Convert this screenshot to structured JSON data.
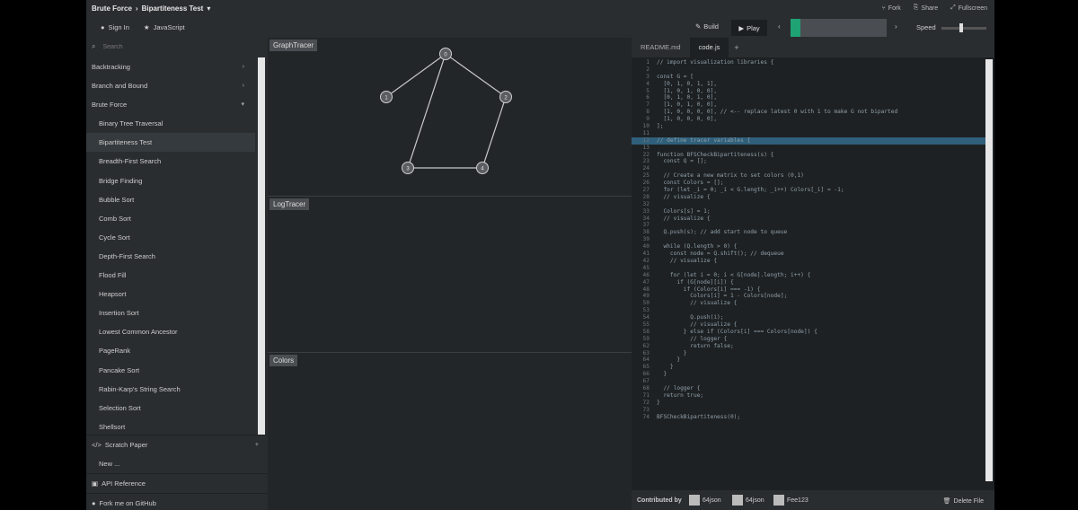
{
  "header": {
    "breadcrumb_root": "Brute Force",
    "breadcrumb_sep": "›",
    "breadcrumb_leaf": "Bipartiteness Test",
    "right_links": [
      "Fork",
      "Share",
      "Fullscreen"
    ]
  },
  "toolbar": {
    "sign_in": "Sign In",
    "language": "JavaScript",
    "build": "Build",
    "play": "Play",
    "speed_label": "Speed",
    "progress": 0.1,
    "speed": 0.4
  },
  "sidebar": {
    "search_placeholder": "Search",
    "items": [
      {
        "label": "Backtracking",
        "type": "category",
        "expanded": false
      },
      {
        "label": "Branch and Bound",
        "type": "category",
        "expanded": false
      },
      {
        "label": "Brute Force",
        "type": "category",
        "expanded": true
      },
      {
        "label": "Binary Tree Traversal",
        "type": "item"
      },
      {
        "label": "Bipartiteness Test",
        "type": "item",
        "active": true
      },
      {
        "label": "Breadth-First Search",
        "type": "item"
      },
      {
        "label": "Bridge Finding",
        "type": "item"
      },
      {
        "label": "Bubble Sort",
        "type": "item"
      },
      {
        "label": "Comb Sort",
        "type": "item"
      },
      {
        "label": "Cycle Sort",
        "type": "item"
      },
      {
        "label": "Depth-First Search",
        "type": "item"
      },
      {
        "label": "Flood Fill",
        "type": "item"
      },
      {
        "label": "Heapsort",
        "type": "item"
      },
      {
        "label": "Insertion Sort",
        "type": "item"
      },
      {
        "label": "Lowest Common Ancestor",
        "type": "item"
      },
      {
        "label": "PageRank",
        "type": "item"
      },
      {
        "label": "Pancake Sort",
        "type": "item"
      },
      {
        "label": "Rabin-Karp's String Search",
        "type": "item"
      },
      {
        "label": "Selection Sort",
        "type": "item"
      },
      {
        "label": "Shellsort",
        "type": "item"
      }
    ],
    "scratch_paper": "Scratch Paper",
    "new_item": "New ...",
    "api_reference": "API Reference",
    "fork_github": "Fork me on GitHub"
  },
  "panels": {
    "graph_tracer": "GraphTracer",
    "log_tracer": "LogTracer",
    "colors": "Colors"
  },
  "graph": {
    "nodes": [
      {
        "id": "0",
        "label": "0"
      },
      {
        "id": "1",
        "label": "1"
      },
      {
        "id": "2",
        "label": "2"
      },
      {
        "id": "3",
        "label": "3"
      },
      {
        "id": "4",
        "label": "4"
      }
    ],
    "edges": [
      [
        "0",
        "1"
      ],
      [
        "0",
        "2"
      ],
      [
        "0",
        "3"
      ],
      [
        "2",
        "4"
      ],
      [
        "3",
        "4"
      ]
    ]
  },
  "editor": {
    "tabs": [
      "README.md",
      "code.js"
    ],
    "active_tab": 1,
    "add_tab": "+",
    "lines": [
      {
        "n": "1",
        "t": "// import visualization libraries {"
      },
      {
        "n": "2",
        "t": ""
      },
      {
        "n": "3",
        "t": "const G = ["
      },
      {
        "n": "4",
        "t": "  [0, 1, 0, 1, 1],"
      },
      {
        "n": "5",
        "t": "  [1, 0, 1, 0, 0],"
      },
      {
        "n": "6",
        "t": "  [0, 1, 0, 1, 0],"
      },
      {
        "n": "7",
        "t": "  [1, 0, 1, 0, 0],"
      },
      {
        "n": "8",
        "t": "  [1, 0, 0, 0, 0], // <-- replace latest 0 with 1 to make G not biparted"
      },
      {
        "n": "9",
        "t": "  [1, 0, 0, 0, 0],"
      },
      {
        "n": "10",
        "t": "];"
      },
      {
        "n": "11",
        "t": ""
      },
      {
        "n": "12",
        "t": "// define tracer variables {",
        "hl": true
      },
      {
        "n": "13",
        "t": ""
      },
      {
        "n": "22",
        "t": "function BFSCheckBipartiteness(s) {"
      },
      {
        "n": "23",
        "t": "  const Q = [];"
      },
      {
        "n": "24",
        "t": ""
      },
      {
        "n": "25",
        "t": "  // Create a new matrix to set colors (0,1)"
      },
      {
        "n": "26",
        "t": "  const Colors = [];"
      },
      {
        "n": "27",
        "t": "  for (let _i = 0; _i < G.length; _i++) Colors[_i] = -1;"
      },
      {
        "n": "28",
        "t": "  // visualize {"
      },
      {
        "n": "32",
        "t": ""
      },
      {
        "n": "33",
        "t": "  Colors[s] = 1;"
      },
      {
        "n": "34",
        "t": "  // visualize {"
      },
      {
        "n": "37",
        "t": ""
      },
      {
        "n": "38",
        "t": "  Q.push(s); // add start node to queue"
      },
      {
        "n": "39",
        "t": ""
      },
      {
        "n": "40",
        "t": "  while (Q.length > 0) {"
      },
      {
        "n": "41",
        "t": "    const node = Q.shift(); // dequeue"
      },
      {
        "n": "42",
        "t": "    // visualize {"
      },
      {
        "n": "45",
        "t": ""
      },
      {
        "n": "46",
        "t": "    for (let i = 0; i < G[node].length; i++) {"
      },
      {
        "n": "47",
        "t": "      if (G[node][i]) {"
      },
      {
        "n": "48",
        "t": "        if (Colors[i] === -1) {"
      },
      {
        "n": "49",
        "t": "          Colors[i] = 1 - Colors[node];"
      },
      {
        "n": "50",
        "t": "          // visualize {"
      },
      {
        "n": "53",
        "t": ""
      },
      {
        "n": "54",
        "t": "          Q.push(i);"
      },
      {
        "n": "55",
        "t": "          // visualize {"
      },
      {
        "n": "58",
        "t": "        } else if (Colors[i] === Colors[node]) {"
      },
      {
        "n": "59",
        "t": "          // logger {"
      },
      {
        "n": "62",
        "t": "          return false;"
      },
      {
        "n": "63",
        "t": "        }"
      },
      {
        "n": "64",
        "t": "      }"
      },
      {
        "n": "65",
        "t": "    }"
      },
      {
        "n": "66",
        "t": "  }"
      },
      {
        "n": "67",
        "t": ""
      },
      {
        "n": "68",
        "t": "  // logger {"
      },
      {
        "n": "71",
        "t": "  return true;"
      },
      {
        "n": "72",
        "t": "}"
      },
      {
        "n": "73",
        "t": ""
      },
      {
        "n": "74",
        "t": "BFSCheckBipartiteness(0);"
      }
    ]
  },
  "footer": {
    "contributed_by": "Contributed by",
    "contributors": [
      "64json",
      "64json",
      "Fee123"
    ],
    "delete_file": "Delete File"
  },
  "colors": {
    "accent": "#1fa374",
    "highlight": "#2f5f7a",
    "panel_bg": "#232629"
  }
}
